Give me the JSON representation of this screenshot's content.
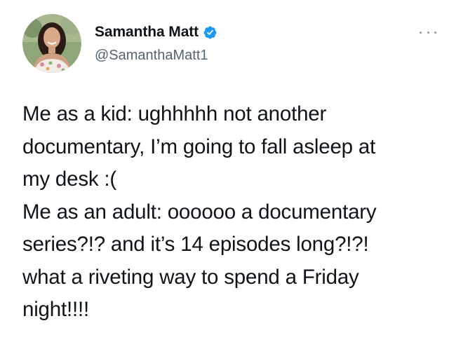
{
  "tweet": {
    "author": {
      "display_name": "Samantha Matt",
      "handle": "@SamanthaMatt1",
      "verified": true,
      "verified_icon": "verified-badge-icon",
      "avatar_icon": "profile-photo"
    },
    "more_icon": "more-options-icon",
    "text": "Me as a kid: ughhhhh not another\ndocumentary, I’m going to fall asleep at\nmy desk :(\nMe as an adult: oooooo a documentary\nseries?!? and it’s 14 episodes long?!?!\nwhat a riveting way to spend a Friday\nnight!!!!"
  },
  "colors": {
    "text": "#0f1419",
    "secondary_text": "#536471",
    "verified_blue": "#1d9bf0",
    "background": "#ffffff"
  }
}
